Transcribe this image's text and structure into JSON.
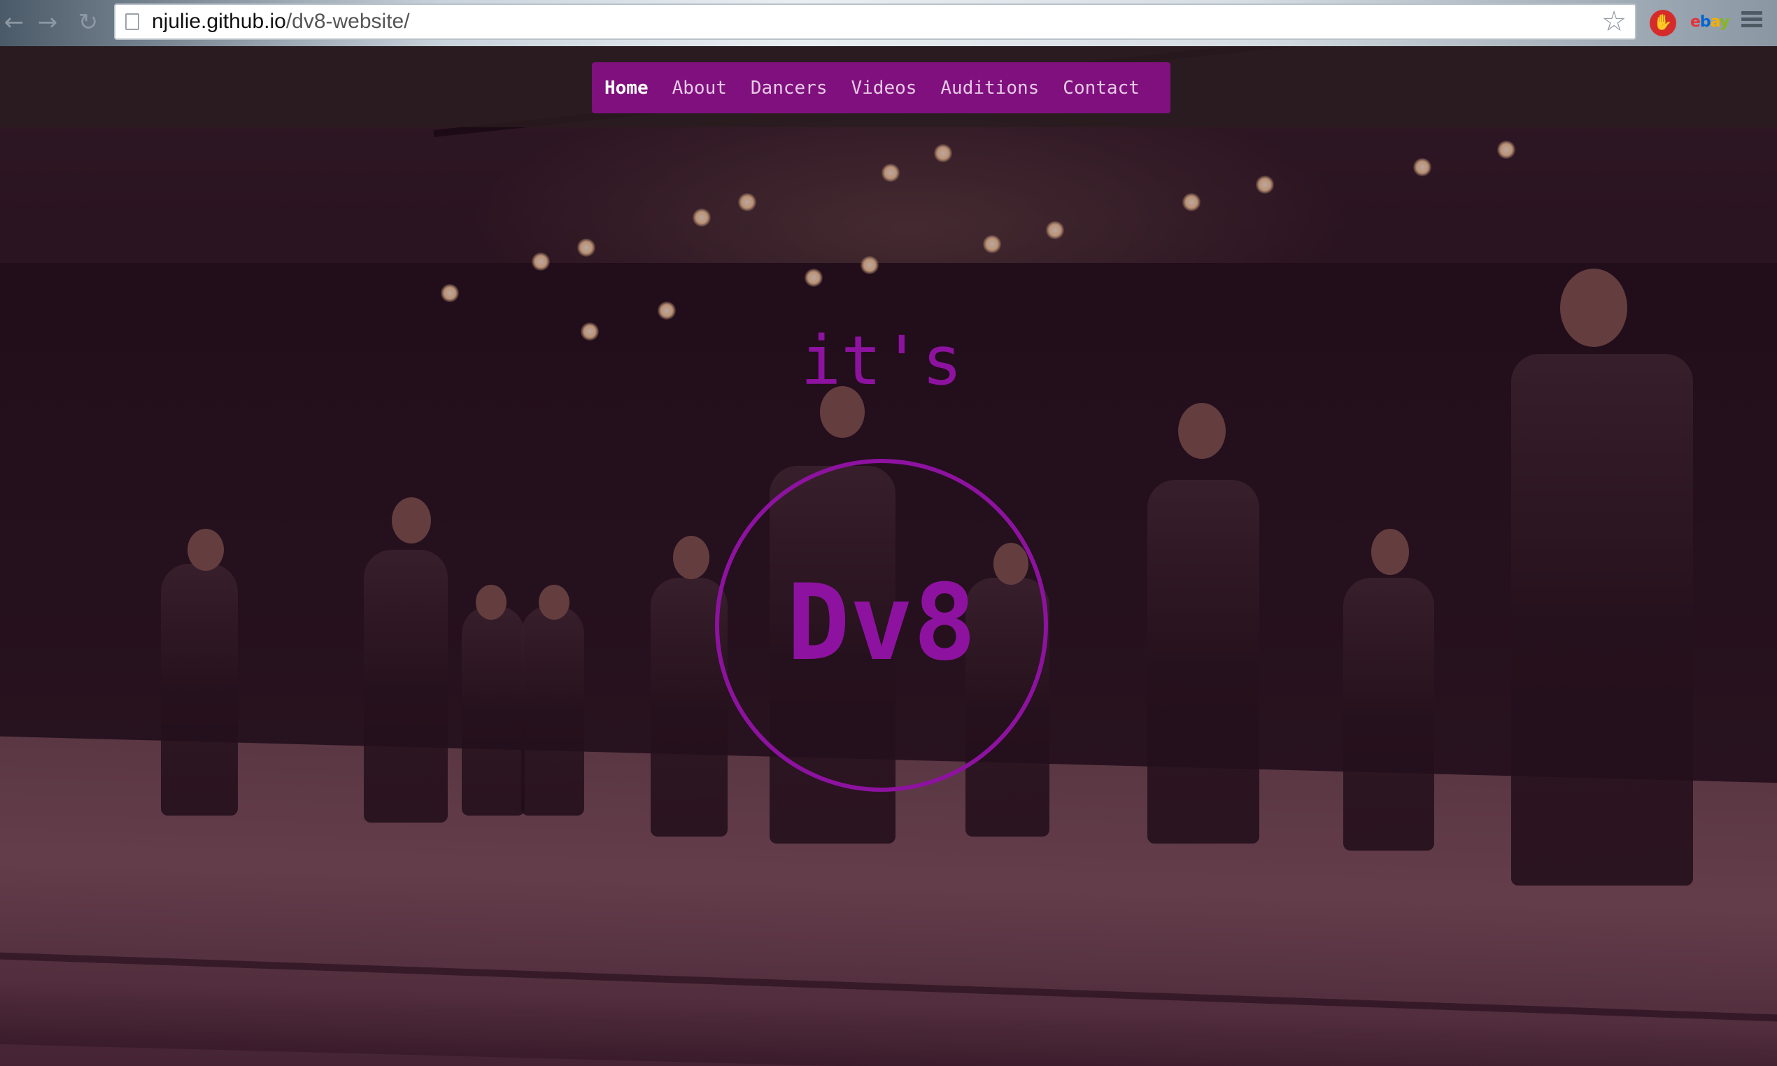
{
  "browser": {
    "url_host": "njulie.github.io",
    "url_path": "/dv8-website/",
    "back_glyph": "←",
    "forward_glyph": "→",
    "reload_glyph": "↻",
    "star_glyph": "☆",
    "extensions": {
      "adblock_glyph": "✋",
      "ebay_letters": [
        "e",
        "b",
        "a",
        "y"
      ]
    }
  },
  "nav": {
    "items": [
      {
        "label": "Home",
        "active": true
      },
      {
        "label": "About",
        "active": false
      },
      {
        "label": "Dancers",
        "active": false
      },
      {
        "label": "Videos",
        "active": false
      },
      {
        "label": "Auditions",
        "active": false
      },
      {
        "label": "Contact",
        "active": false
      }
    ]
  },
  "hero": {
    "tagline": "it's",
    "logo_text": "Dv8"
  },
  "colors": {
    "accent": "#80107e",
    "hero_text": "#8e12a0",
    "nav_text": "#e6c9e5"
  },
  "icons": {
    "back": "back-arrow-icon",
    "forward": "forward-arrow-icon",
    "reload": "reload-icon",
    "page": "page-icon",
    "star": "star-icon",
    "adblock": "adblock-icon",
    "ebay": "ebay-icon",
    "menu": "menu-icon"
  }
}
